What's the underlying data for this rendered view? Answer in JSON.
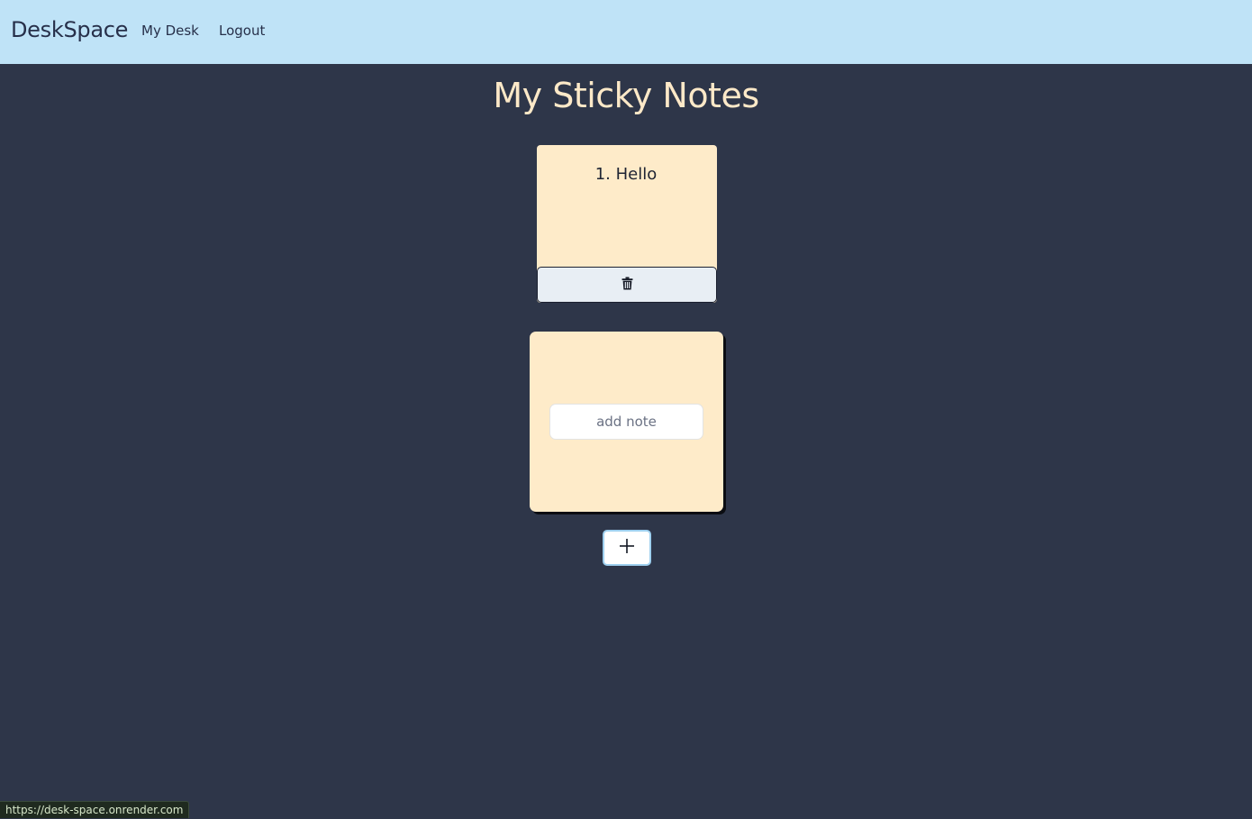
{
  "navbar": {
    "brand": "DeskSpace",
    "links": [
      {
        "label": "My Desk"
      },
      {
        "label": "Logout"
      }
    ]
  },
  "page": {
    "title": "My Sticky Notes"
  },
  "notes": [
    {
      "text": "1. Hello"
    }
  ],
  "new_note": {
    "placeholder": "add note",
    "value": ""
  },
  "icons": {
    "delete": "trash-icon",
    "add": "plus-icon"
  },
  "status_bar": {
    "url": "https://desk-space.onrender.com"
  },
  "colors": {
    "navbar_bg": "#bfe3f7",
    "page_bg": "#2e3649",
    "note_bg": "#feebc9",
    "title_color": "#fde9c8"
  }
}
